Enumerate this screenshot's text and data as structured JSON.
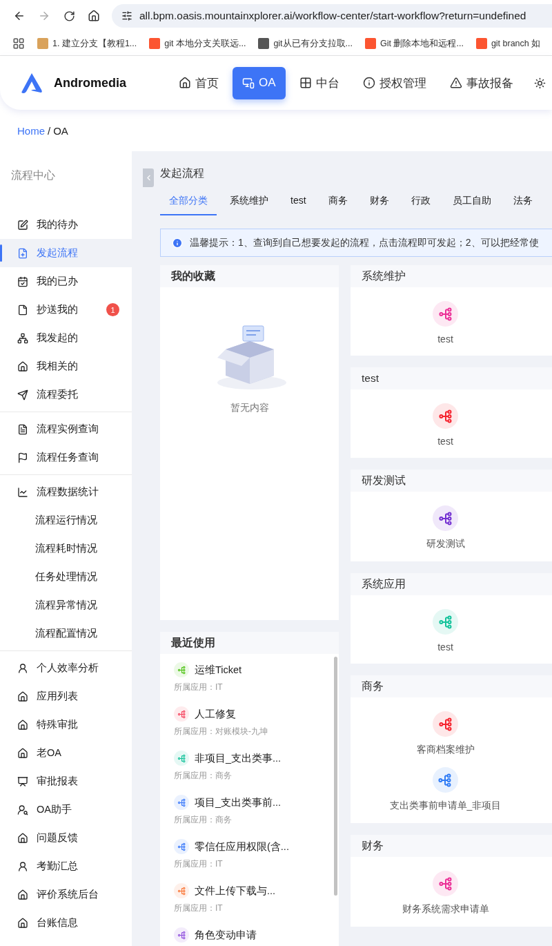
{
  "browser": {
    "url": "all.bpm.oasis.mountainxplorer.ai/workflow-center/start-workflow?return=undefined",
    "bookmarks": [
      {
        "label": "1. 建立分支【教程1..."
      },
      {
        "label": "git 本地分支关联远..."
      },
      {
        "label": "git从已有分支拉取..."
      },
      {
        "label": "Git 删除本地和远程..."
      },
      {
        "label": "git branch 如"
      }
    ]
  },
  "header": {
    "brand": "Andromedia",
    "nav": [
      {
        "label": "首页",
        "selected": false
      },
      {
        "label": "OA",
        "selected": true
      },
      {
        "label": "中台",
        "selected": false
      },
      {
        "label": "授权管理",
        "selected": false
      },
      {
        "label": "事故报备",
        "selected": false
      }
    ]
  },
  "breadcrumb": {
    "link": "Home",
    "separator": "/",
    "current": "OA"
  },
  "sidebar": {
    "title": "流程中心",
    "groups": [
      [
        {
          "label": "我的待办",
          "selected": false
        },
        {
          "label": "发起流程",
          "selected": true
        },
        {
          "label": "我的已办",
          "selected": false
        },
        {
          "label": "抄送我的",
          "selected": false,
          "badge": "1"
        },
        {
          "label": "我发起的",
          "selected": false
        },
        {
          "label": "我相关的",
          "selected": false
        },
        {
          "label": "流程委托",
          "selected": false
        }
      ],
      [
        {
          "label": "流程实例查询",
          "selected": false
        },
        {
          "label": "流程任务查询",
          "selected": false
        }
      ],
      [
        {
          "label": "流程数据统计",
          "selected": false,
          "children": [
            {
              "label": "流程运行情况",
              "selected": false
            },
            {
              "label": "流程耗时情况",
              "selected": false
            },
            {
              "label": "任务处理情况",
              "selected": false
            },
            {
              "label": "流程异常情况",
              "selected": false
            },
            {
              "label": "流程配置情况",
              "selected": false
            }
          ]
        }
      ],
      [
        {
          "label": "个人效率分析",
          "selected": false
        },
        {
          "label": "应用列表",
          "selected": false
        },
        {
          "label": "特殊审批",
          "selected": false
        },
        {
          "label": "老OA",
          "selected": false
        },
        {
          "label": "审批报表",
          "selected": false
        },
        {
          "label": "OA助手",
          "selected": false
        },
        {
          "label": "问题反馈",
          "selected": false
        },
        {
          "label": "考勤汇总",
          "selected": false
        },
        {
          "label": "评价系统后台",
          "selected": false
        },
        {
          "label": "台账信息",
          "selected": false
        }
      ]
    ]
  },
  "main": {
    "title": "发起流程",
    "tabs": [
      {
        "label": "全部分类",
        "selected": true
      },
      {
        "label": "系统维护",
        "selected": false
      },
      {
        "label": "test",
        "selected": false
      },
      {
        "label": "商务",
        "selected": false
      },
      {
        "label": "财务",
        "selected": false
      },
      {
        "label": "行政",
        "selected": false
      },
      {
        "label": "员工自助",
        "selected": false
      },
      {
        "label": "法务",
        "selected": false
      }
    ],
    "notice": "温馨提示：1、查询到自己想要发起的流程，点击流程即可发起；2、可以把经常使",
    "favorites": {
      "title": "我的收藏",
      "empty_text": "暂无内容"
    },
    "recent": {
      "title": "最近使用",
      "items": [
        {
          "name": "运维Ticket",
          "app": "所属应用：IT",
          "color": "#52c41a"
        },
        {
          "name": "人工修复",
          "app": "所属应用：对账模块-九坤",
          "color": "#f5455f"
        },
        {
          "name": "非项目_支出类事...",
          "app": "所属应用：商务",
          "color": "#13c29a"
        },
        {
          "name": "项目_支出类事前...",
          "app": "所属应用：商务",
          "color": "#3d7bfa"
        },
        {
          "name": "零信任应用权限(含...",
          "app": "所属应用：IT",
          "color": "#3d7bfa"
        },
        {
          "name": "文件上传下载与...",
          "app": "所属应用：IT",
          "color": "#fa7a3c"
        },
        {
          "name": "角色变动申请",
          "color": "#9254de"
        }
      ]
    },
    "categories": [
      {
        "title": "系统维护",
        "items": [
          {
            "name": "test",
            "color": "#eb2f96"
          }
        ]
      },
      {
        "title": "test",
        "items": [
          {
            "name": "test",
            "color": "#f5222d"
          }
        ]
      },
      {
        "title": "研发测试",
        "items": [
          {
            "name": "研发测试",
            "color": "#722ed1"
          }
        ]
      },
      {
        "title": "系统应用",
        "items": [
          {
            "name": "test",
            "color": "#13c29a"
          }
        ]
      },
      {
        "title": "商务",
        "items": [
          {
            "name": "客商档案维护",
            "color": "#f5222d"
          },
          {
            "name": "支出类事前申请单_非项目",
            "color": "#2f7bf5"
          }
        ]
      },
      {
        "title": "财务",
        "items": [
          {
            "name": "财务系统需求申请单",
            "color": "#eb2f96"
          }
        ]
      }
    ]
  }
}
